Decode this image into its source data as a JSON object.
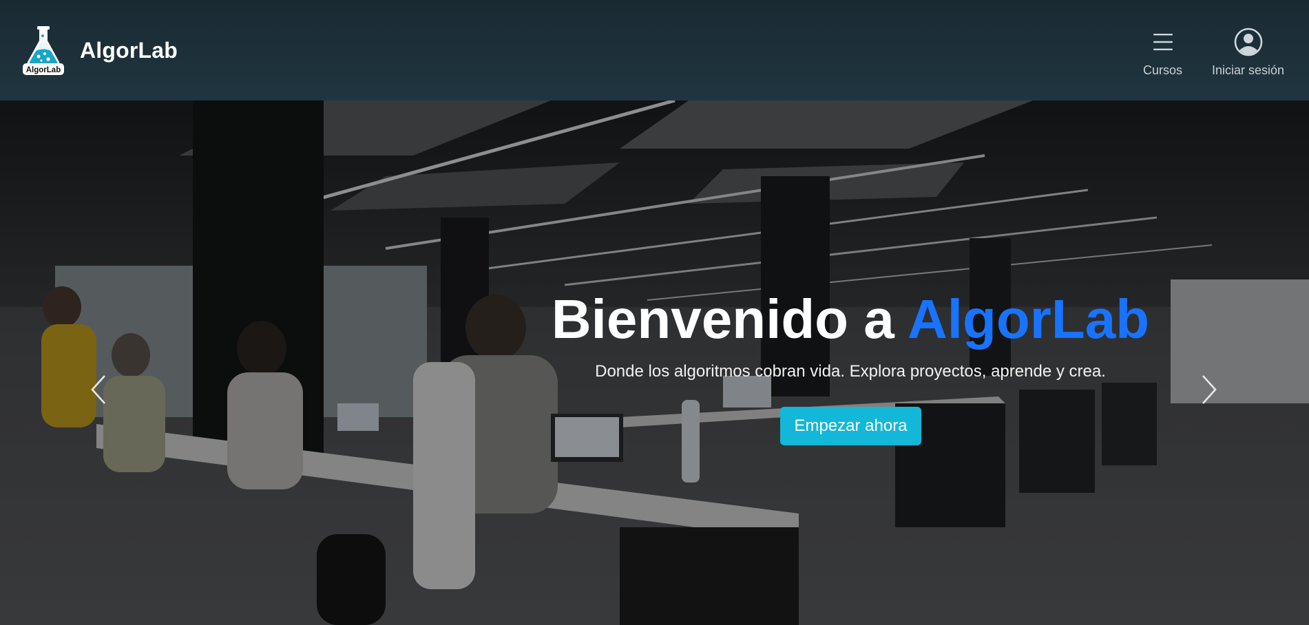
{
  "navbar": {
    "brand_name": "AlgorLab",
    "logo_badge": "AlgorLab",
    "items": [
      {
        "label": "Cursos",
        "icon": "menu-icon"
      },
      {
        "label": "Iniciar sesión",
        "icon": "user-circle-icon"
      }
    ]
  },
  "hero": {
    "title_prefix": "Bienvenido a ",
    "title_accent": "AlgorLab",
    "subtitle": "Donde los algoritmos cobran vida. Explora proyectos, aprende y crea.",
    "cta_label": "Empezar ahora",
    "prev_icon": "chevron-left-icon",
    "next_icon": "chevron-right-icon",
    "background": "office-workspace-photo"
  },
  "colors": {
    "navbar_bg": "#1a2a33",
    "accent_blue": "#1873ff",
    "cta_bg": "#13b8d8",
    "logo_teal": "#1aa6c6"
  }
}
